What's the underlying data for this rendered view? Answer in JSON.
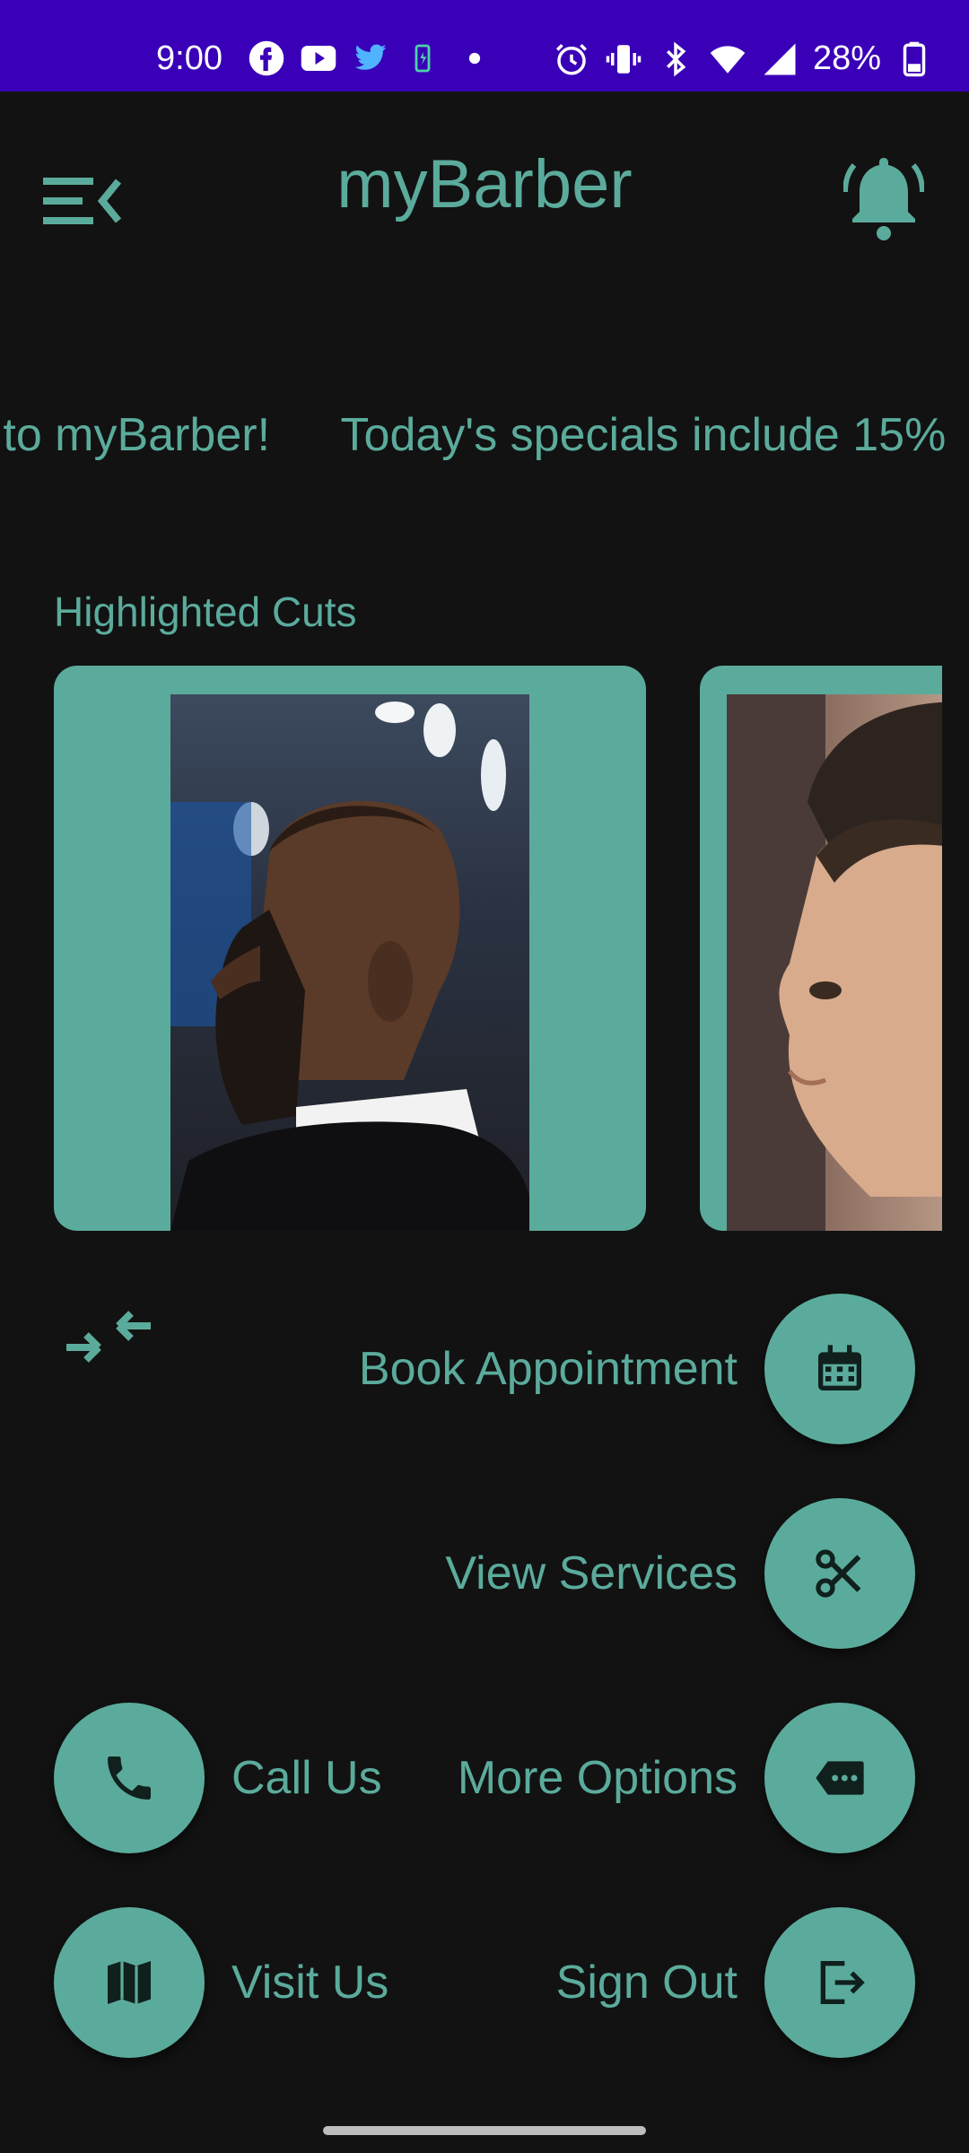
{
  "status_bar": {
    "time": "9:00",
    "battery": "28%",
    "icons": [
      "facebook-icon",
      "youtube-icon",
      "twitter-icon",
      "battery-saver-icon",
      "dot-icon",
      "alarm-icon",
      "vibrate-icon",
      "bluetooth-icon",
      "wifi-icon",
      "signal-icon",
      "battery-icon"
    ]
  },
  "app_bar": {
    "title": "myBarber",
    "menu_icon": "menu-open-icon",
    "notification_icon": "bell-icon"
  },
  "marquee": {
    "segments": [
      "e to myBarber!",
      "Today's specials include 15%"
    ]
  },
  "highlighted": {
    "title": "Highlighted Cuts"
  },
  "actions": {
    "book": {
      "label": "Book Appointment",
      "icon": "calendar-icon"
    },
    "services": {
      "label": "View Services",
      "icon": "scissors-icon"
    },
    "call": {
      "label": "Call Us",
      "icon": "phone-icon"
    },
    "more": {
      "label": "More Options",
      "icon": "more-options-icon"
    },
    "visit": {
      "label": "Visit Us",
      "icon": "map-icon"
    },
    "signout": {
      "label": "Sign Out",
      "icon": "logout-icon"
    }
  },
  "colors": {
    "accent": "#5bab9c",
    "background": "#121212",
    "status_bar": "#3a00b8"
  }
}
